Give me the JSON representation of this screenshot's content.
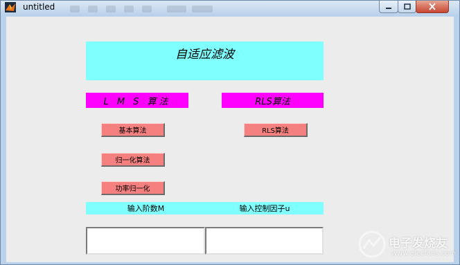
{
  "window": {
    "title": "untitled",
    "client_bg": "#ececec"
  },
  "panel": {
    "title": "自适应滤波",
    "title_bg": "#80ffff",
    "header_bg": "#ff00ff",
    "button_bg": "#f58080"
  },
  "lms": {
    "header": "L M S 算法",
    "buttons": [
      "基本算法",
      "归一化算法",
      "功率归一化"
    ]
  },
  "rls": {
    "header": "RLS算法",
    "button": "RLS算法"
  },
  "inputs": {
    "order_label": "输入阶数M",
    "order_value": "",
    "factor_label": "输入控制因子u",
    "factor_value": ""
  },
  "watermark": {
    "text": "电子发烧友",
    "url": "www.elecfans.com",
    "logo": "electronic-logo-icon"
  }
}
